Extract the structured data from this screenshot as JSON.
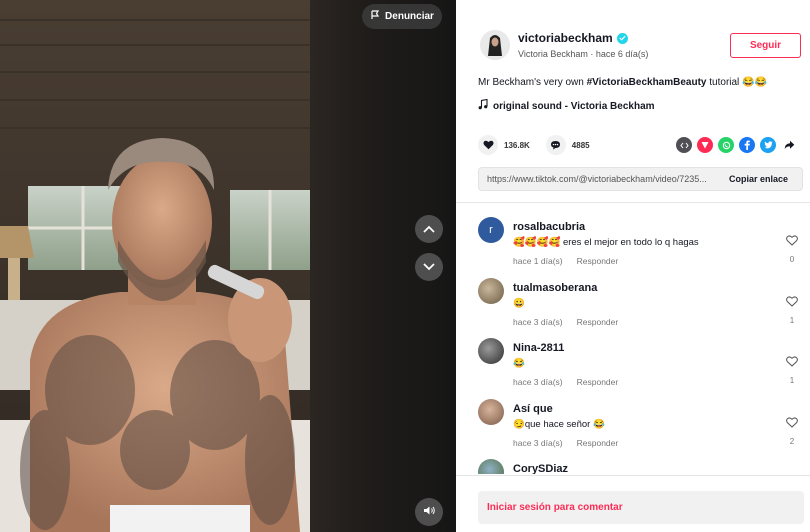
{
  "video": {
    "report_label": "Denunciar"
  },
  "author": {
    "username": "victoriabeckham",
    "display_name": "Victoria Beckham",
    "time_ago": "hace 6 día(s)",
    "follow_label": "Seguir"
  },
  "caption": {
    "prefix": "Mr Beckham's very own ",
    "hashtag": "#VictoriaBeckhamBeauty",
    "suffix": " tutorial ",
    "emoji": "😂😂"
  },
  "sound": {
    "label": "original sound - Victoria Beckham"
  },
  "stats": {
    "likes": "136.8K",
    "comments": "4885"
  },
  "share": {
    "url": "https://www.tiktok.com/@victoriabeckham/video/7235...",
    "copy_label": "Copiar enlace",
    "icons": [
      "embed-icon",
      "send-icon",
      "whatsapp-icon",
      "facebook-icon",
      "twitter-icon",
      "share-arrow-icon"
    ]
  },
  "comments": [
    {
      "name": "rosalbacubria",
      "text": "🥰🥰🥰🥰 eres el mejor en todo lo q hagas",
      "time": "hace 1 día(s)",
      "reply": "Responder",
      "likes": "0"
    },
    {
      "name": "tualmasoberana",
      "text": "😀",
      "time": "hace 3 día(s)",
      "reply": "Responder",
      "likes": "1"
    },
    {
      "name": "Nina-2811",
      "text": "😂",
      "time": "hace 3 día(s)",
      "reply": "Responder",
      "likes": "1"
    },
    {
      "name": "Así que",
      "text": "😏que hace señor 😂",
      "time": "hace 3 día(s)",
      "reply": "Responder",
      "likes": "2"
    },
    {
      "name": "CorySDiaz",
      "text": "",
      "time": "",
      "reply": "",
      "likes": ""
    }
  ],
  "footer": {
    "login_label": "Iniciar sesión para comentar"
  },
  "colors": {
    "accent": "#fe2c55",
    "verified": "#20d5ec"
  }
}
